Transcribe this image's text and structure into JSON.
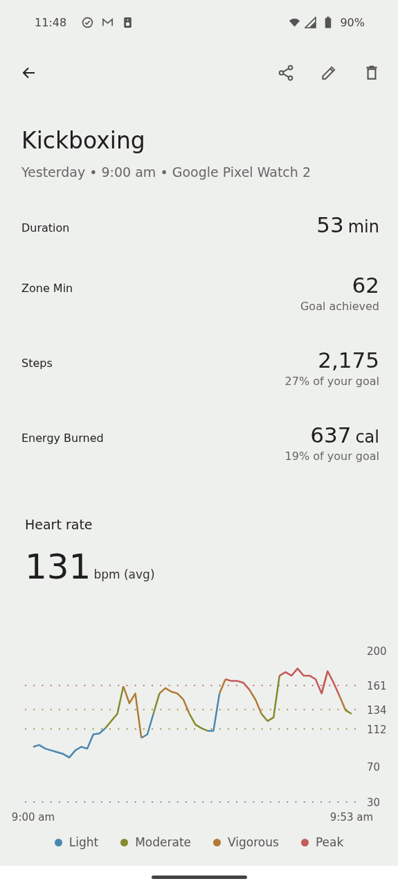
{
  "status_bar": {
    "time": "11:48",
    "battery": "90%"
  },
  "title": "Kickboxing",
  "subtitle": "Yesterday • 9:00 am • Google Pixel Watch 2",
  "stats": [
    {
      "label": "Duration",
      "value": "53",
      "unit": "min"
    },
    {
      "label": "Zone Min",
      "value": "62",
      "note": "Goal achieved"
    },
    {
      "label": "Steps",
      "value": "2,175",
      "note": "27% of your goal"
    },
    {
      "label": "Energy Burned",
      "value": "637",
      "unit": "cal",
      "note": "19% of your goal"
    }
  ],
  "heart_rate": {
    "title": "Heart rate",
    "value": "131",
    "unit": "bpm (avg)",
    "chart_data": {
      "type": "line",
      "categories": [
        "9:00 am",
        null,
        null,
        null,
        null,
        null,
        null,
        null,
        null,
        null,
        null,
        null,
        null,
        null,
        null,
        null,
        null,
        null,
        null,
        null,
        null,
        null,
        null,
        null,
        null,
        null,
        null,
        null,
        null,
        null,
        null,
        null,
        null,
        null,
        null,
        null,
        null,
        null,
        null,
        null,
        null,
        null,
        null,
        null,
        null,
        null,
        null,
        null,
        null,
        null,
        null,
        null,
        null,
        "9:53 am"
      ],
      "ylim": [
        30,
        200
      ],
      "yticks": [
        30,
        70,
        112,
        134,
        161,
        200
      ],
      "ref_lines": [
        {
          "axis": "y",
          "value": 30,
          "color": "#4a86b0"
        },
        {
          "axis": "y",
          "value": 112,
          "color": "#858a2c"
        },
        {
          "axis": "y",
          "value": 134,
          "color": "#b07a34"
        },
        {
          "axis": "y",
          "value": 161,
          "color": "#c55a5a"
        }
      ],
      "series": [
        {
          "name": "Light",
          "color": "#4a86b0",
          "values": [
            92,
            94,
            90,
            88,
            86,
            84,
            80,
            88,
            92,
            90,
            106,
            107,
            113,
            null,
            null,
            null,
            null,
            null,
            102,
            106,
            129,
            null,
            null,
            null,
            null,
            null,
            null,
            null,
            null,
            110,
            110,
            152,
            null,
            null,
            null,
            null,
            null,
            null,
            null,
            null,
            null,
            null,
            null,
            null,
            null,
            null,
            null,
            null,
            null,
            null,
            null,
            null,
            null,
            null
          ]
        },
        {
          "name": "Moderate",
          "color": "#858a2c",
          "values": [
            null,
            null,
            null,
            null,
            null,
            null,
            null,
            null,
            null,
            null,
            null,
            null,
            113,
            121,
            129,
            160,
            null,
            null,
            null,
            null,
            129,
            152,
            null,
            null,
            null,
            null,
            129,
            117,
            113,
            110,
            null,
            null,
            null,
            null,
            null,
            null,
            null,
            null,
            129,
            121,
            125,
            172,
            null,
            null,
            null,
            null,
            null,
            null,
            null,
            null,
            null,
            null,
            133,
            129
          ]
        },
        {
          "name": "Vigorous",
          "color": "#b07a34",
          "values": [
            null,
            null,
            null,
            null,
            null,
            null,
            null,
            null,
            null,
            null,
            null,
            null,
            null,
            null,
            null,
            160,
            141,
            152,
            102,
            null,
            null,
            152,
            158,
            154,
            152,
            145,
            129,
            null,
            null,
            null,
            null,
            152,
            168,
            null,
            null,
            null,
            156,
            145,
            129,
            null,
            null,
            null,
            null,
            null,
            null,
            null,
            null,
            null,
            152,
            177,
            null,
            149,
            133,
            null
          ]
        },
        {
          "name": "Peak",
          "color": "#c55a5a",
          "values": [
            null,
            null,
            null,
            null,
            null,
            null,
            null,
            null,
            null,
            null,
            null,
            null,
            null,
            null,
            null,
            null,
            null,
            null,
            null,
            null,
            null,
            null,
            null,
            null,
            null,
            null,
            null,
            null,
            null,
            null,
            null,
            null,
            168,
            166,
            166,
            164,
            156,
            null,
            null,
            null,
            null,
            172,
            176,
            172,
            180,
            172,
            172,
            168,
            152,
            177,
            164,
            149,
            null,
            null
          ]
        }
      ]
    }
  }
}
